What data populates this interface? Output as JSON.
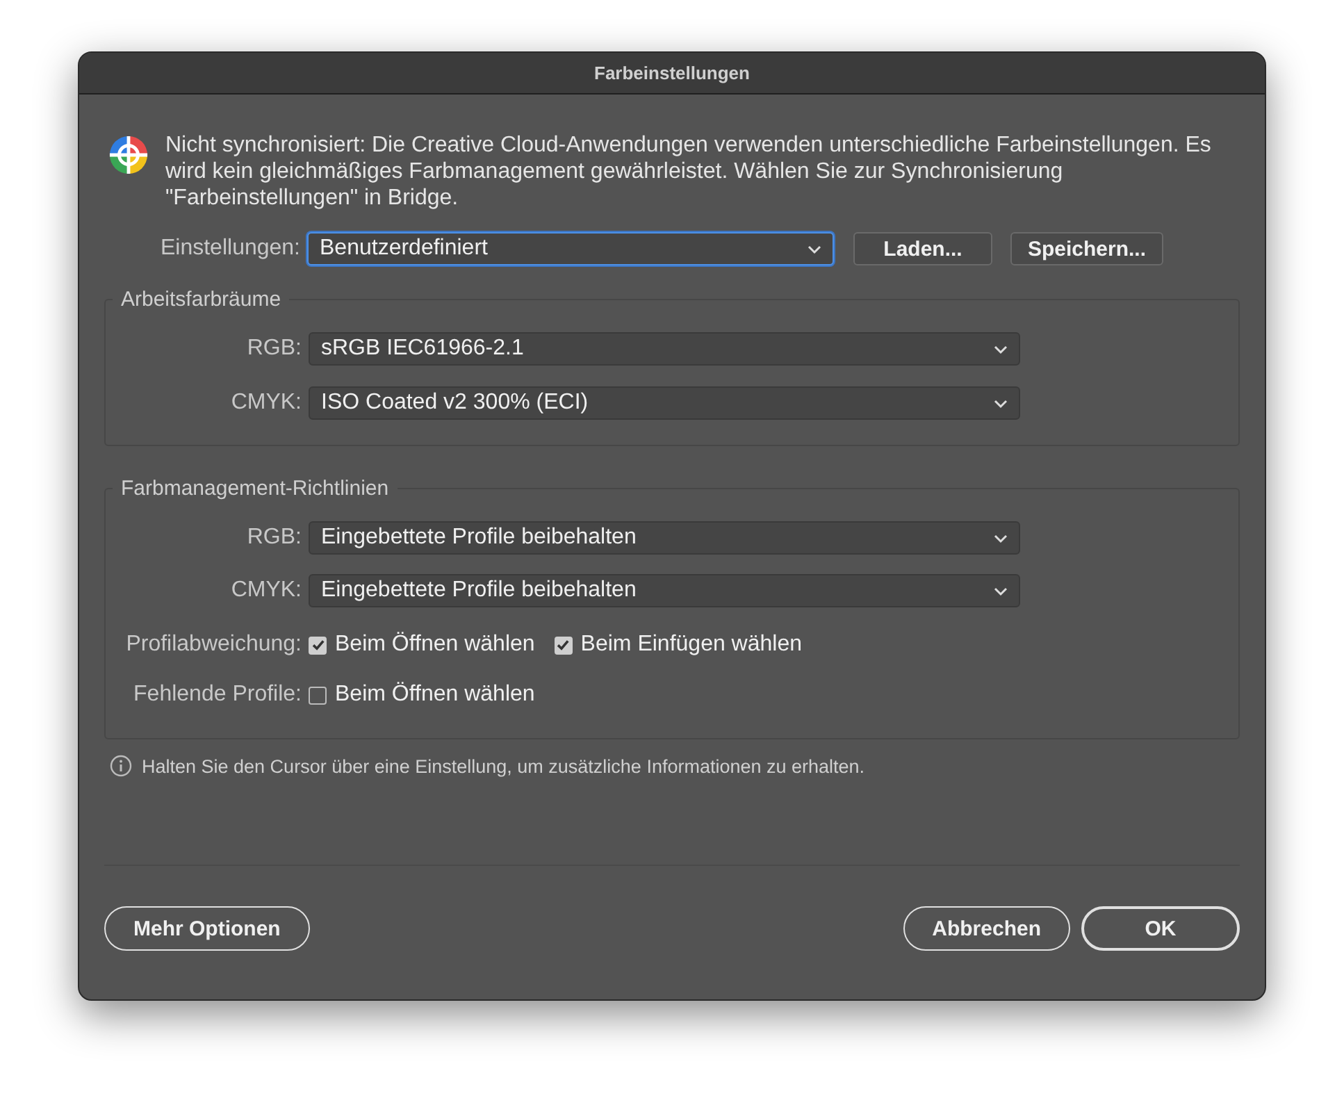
{
  "window": {
    "title": "Farbeinstellungen"
  },
  "notice": "Nicht synchronisiert: Die Creative Cloud-Anwendungen verwenden unterschiedliche Farbeinstellungen. Es wird kein gleichmäßiges Farbmanagement gewährleistet. Wählen Sie zur Synchronisierung \"Farbeinstellungen\" in Bridge.",
  "settings": {
    "label": "Einstellungen:",
    "value": "Benutzerdefiniert",
    "focused": true,
    "buttons": [
      "Laden...",
      "Speichern..."
    ]
  },
  "groups": [
    {
      "title": "Arbeitsfarbräume",
      "rows": [
        {
          "kind": "dropdown",
          "label": "RGB:",
          "value": "sRGB IEC61966-2.1",
          "focused": false
        },
        {
          "kind": "dropdown",
          "label": "CMYK:",
          "value": "ISO Coated v2 300% (ECI)",
          "focused": false
        }
      ]
    },
    {
      "title": "Farbmanagement-Richtlinien",
      "rows": [
        {
          "kind": "dropdown",
          "label": "RGB:",
          "value": "Eingebettete Profile beibehalten",
          "focused": false
        },
        {
          "kind": "dropdown",
          "label": "CMYK:",
          "value": "Eingebettete Profile beibehalten",
          "focused": false
        },
        {
          "kind": "checkboxes",
          "label": "Profilabweichung:",
          "options": [
            {
              "label": "Beim Öffnen wählen",
              "checked": true
            },
            {
              "label": "Beim Einfügen wählen",
              "checked": true
            }
          ]
        },
        {
          "kind": "checkboxes",
          "label": "Fehlende Profile:",
          "options": [
            {
              "label": "Beim Öffnen wählen",
              "checked": false
            }
          ]
        }
      ]
    }
  ],
  "info": "Halten Sie den Cursor über eine Einstellung, um zusätzliche Informationen zu erhalten.",
  "footer": {
    "left": [
      {
        "label": "Mehr Optionen",
        "primary": false
      }
    ],
    "right": [
      {
        "label": "Abbrechen",
        "primary": false
      },
      {
        "label": "OK",
        "primary": true
      }
    ]
  }
}
